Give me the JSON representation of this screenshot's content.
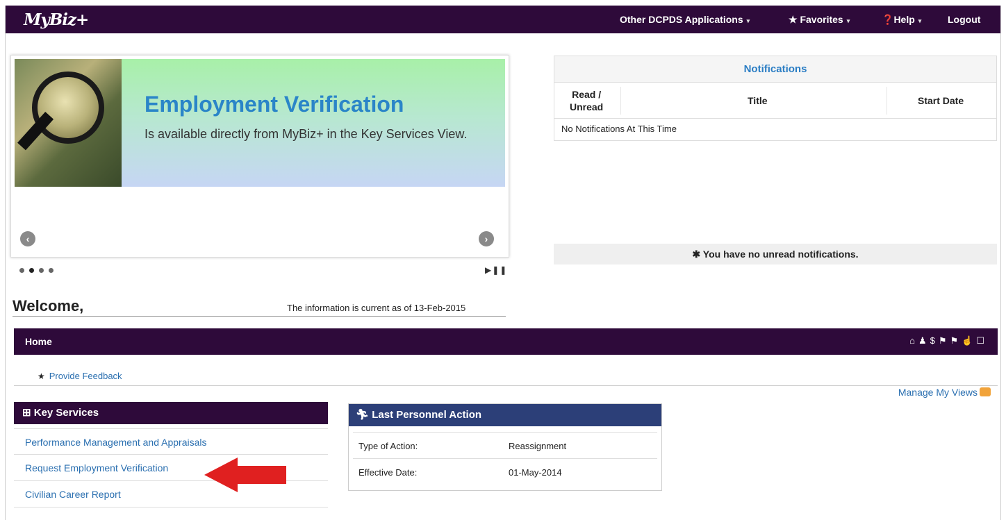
{
  "topnav": {
    "logo": "MyBiz+",
    "other_apps": "Other DCPDS Applications",
    "favorites": "Favorites",
    "help": "Help",
    "logout": "Logout",
    "caret": "▾"
  },
  "carousel": {
    "title": "Employment Verification",
    "subtitle": "Is available directly from MyBiz+ in the Key Services View.",
    "prev_glyph": "‹",
    "next_glyph": "›",
    "play_pause": "▶❚❚",
    "dots": 4,
    "active_dot": 1
  },
  "welcome": {
    "greeting": "Welcome,",
    "current_as_of": "The information is current as of 13-Feb-2015"
  },
  "notifications": {
    "title": "Notifications",
    "columns": [
      "Read /",
      "Unread",
      "Title",
      "Start Date"
    ],
    "empty_message": "No Notifications At This Time",
    "no_unread": "✱ You have no unread notifications."
  },
  "home": {
    "title": "Home",
    "icons": "⌂♟$⚑⚑☝☐",
    "feedback": "Provide Feedback",
    "manage_views": "Manage My Views"
  },
  "key_services": {
    "title": "⊞ Key Services",
    "items": [
      "Performance Management and Appraisals",
      "Request Employment Verification",
      "Civilian Career Report"
    ]
  },
  "last_personnel_action": {
    "title": "Last Personnel Action",
    "rows": [
      {
        "label": "Type of Action:",
        "value": "Reassignment"
      },
      {
        "label": "Effective Date:",
        "value": "01-May-2014"
      }
    ]
  },
  "colors": {
    "nav_purple": "#2e0a3a",
    "link_blue": "#2a6fb0",
    "header_navy": "#2c3f78",
    "arrow_red": "#e02020"
  }
}
